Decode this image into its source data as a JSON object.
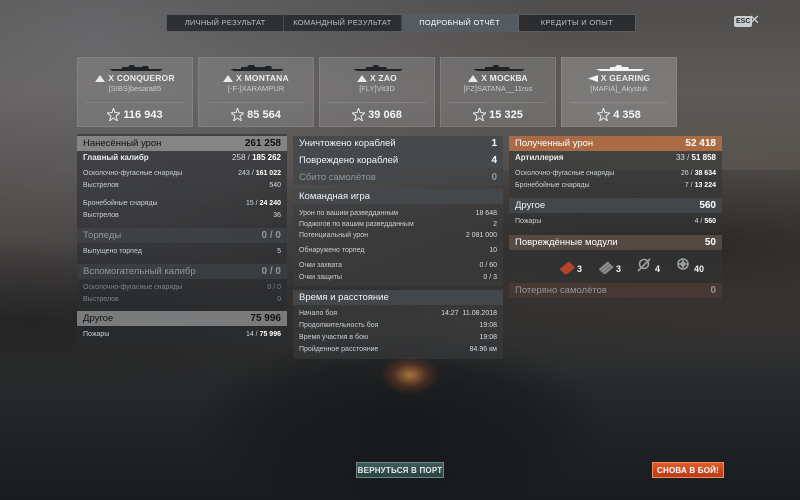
{
  "tabs": [
    {
      "label": "ЛИЧНЫЙ РЕЗУЛЬТАТ",
      "active": false
    },
    {
      "label": "КОМАНДНЫЙ РЕЗУЛЬТАТ",
      "active": false
    },
    {
      "label": "ПОДРОБНЫЙ ОТЧЁТ",
      "active": true
    },
    {
      "label": "КРЕДИТЫ И ОПЫТ",
      "active": false
    }
  ],
  "esc_label": "ESC",
  "close_icon": "close-icon",
  "players": [
    {
      "ship": "X CONQUEROR",
      "player": "[SIBS]besara85",
      "score": "116 943",
      "selected": false
    },
    {
      "ship": "X MONTANA",
      "player": "[-F-]XARAMPUR",
      "score": "85 564",
      "selected": false
    },
    {
      "ship": "X ZAO",
      "player": "[FLY]Vit3D",
      "score": "39 068",
      "selected": false
    },
    {
      "ship": "X МОСКВА",
      "player": "[FZ]SATANA__11rus",
      "score": "15 325",
      "selected": false
    },
    {
      "ship": "X GEARING",
      "player": "[MAFIA]_Akystuk",
      "score": "4 358",
      "selected": true
    }
  ],
  "left": {
    "damage_dealt": {
      "label": "Нанесённый урон",
      "value": "261 258"
    },
    "main_battery": {
      "label": "Главный калибр",
      "hits": "258",
      "total": "185 262"
    },
    "he_shells": {
      "label": "Осколочно-фугасные снаряды",
      "hits": "243",
      "total": "161 022"
    },
    "he_shots": {
      "label": "Выстрелов",
      "value": "540"
    },
    "ap_shells": {
      "label": "Бронебойные снаряды",
      "hits": "15",
      "total": "24 240"
    },
    "ap_shots": {
      "label": "Выстрелов",
      "value": "36"
    },
    "torpedoes": {
      "label": "Торпеды",
      "value": "0 / 0"
    },
    "torpedoes_launched": {
      "label": "Выпущено торпед",
      "value": "5"
    },
    "secondary": {
      "label": "Вспомогательный калибр",
      "value": "0 / 0"
    },
    "sec_he": {
      "label": "Осколочно-фугасные снаряды",
      "value": "0 / 0"
    },
    "sec_shots": {
      "label": "Выстрелов",
      "value": "0"
    },
    "other": {
      "label": "Другое",
      "value": "75 996"
    },
    "fires": {
      "label": "Пожары",
      "hits": "14",
      "total": "75 996"
    }
  },
  "mid": {
    "destroyed": {
      "label": "Уничтожено кораблей",
      "value": "1"
    },
    "damaged": {
      "label": "Повреждено кораблей",
      "value": "4"
    },
    "planes": {
      "label": "Сбито самолётов",
      "value": "0"
    },
    "team_play": {
      "label": "Командная игра"
    },
    "spotting_damage": {
      "label": "Урон по вашим разведданным",
      "value": "18 648"
    },
    "spotting_fires": {
      "label": "Поджогов по вашим разведданным",
      "value": "2"
    },
    "potential": {
      "label": "Потенциальный урон",
      "value": "2 081 000"
    },
    "torps_spotted": {
      "label": "Обнаружено торпед",
      "value": "10"
    },
    "capture": {
      "label": "Очки захвата",
      "value": "0 / 60"
    },
    "defense": {
      "label": "Очки защиты",
      "value": "0 / 3"
    },
    "time_distance": {
      "label": "Время и расстояние"
    },
    "battle_start": {
      "label": "Начало боя",
      "time": "14:27",
      "date": "11.08.2018"
    },
    "duration": {
      "label": "Продолжительность боя",
      "value": "19:08"
    },
    "participation": {
      "label": "Время участия в бою",
      "value": "19:08"
    },
    "distance": {
      "label": "Пройденное расстояние",
      "value": "84.96 км"
    }
  },
  "right": {
    "received": {
      "label": "Полученный урон",
      "value": "52 418"
    },
    "artillery": {
      "label": "Артиллерия",
      "hits": "33",
      "total": "51 858"
    },
    "he_shells": {
      "label": "Осколочно-фугасные снаряды",
      "hits": "26",
      "total": "38 634"
    },
    "ap_shells": {
      "label": "Бронебойные снаряды",
      "hits": "7",
      "total": "13 224"
    },
    "other": {
      "label": "Другое",
      "value": "560"
    },
    "fires": {
      "label": "Пожары",
      "hits": "4",
      "total": "560"
    },
    "modules": {
      "label": "Повреждённые модули",
      "value": "50"
    },
    "module_items": [
      {
        "icon": "torpedo-tubes-icon",
        "count": "3"
      },
      {
        "icon": "main-battery-icon",
        "count": "3"
      },
      {
        "icon": "engine-icon",
        "count": "4"
      },
      {
        "icon": "steering-gear-icon",
        "count": "40"
      }
    ],
    "planes_lost": {
      "label": "Потеряно самолётов",
      "value": "0"
    }
  },
  "buttons": {
    "port": "ВЕРНУТЬСЯ В ПОРТ",
    "battle": "СНОВА В БОЙ!"
  },
  "colors": {
    "accent_orange": "#d0784a",
    "battle_button": "#d84a22",
    "port_button": "#345050"
  }
}
